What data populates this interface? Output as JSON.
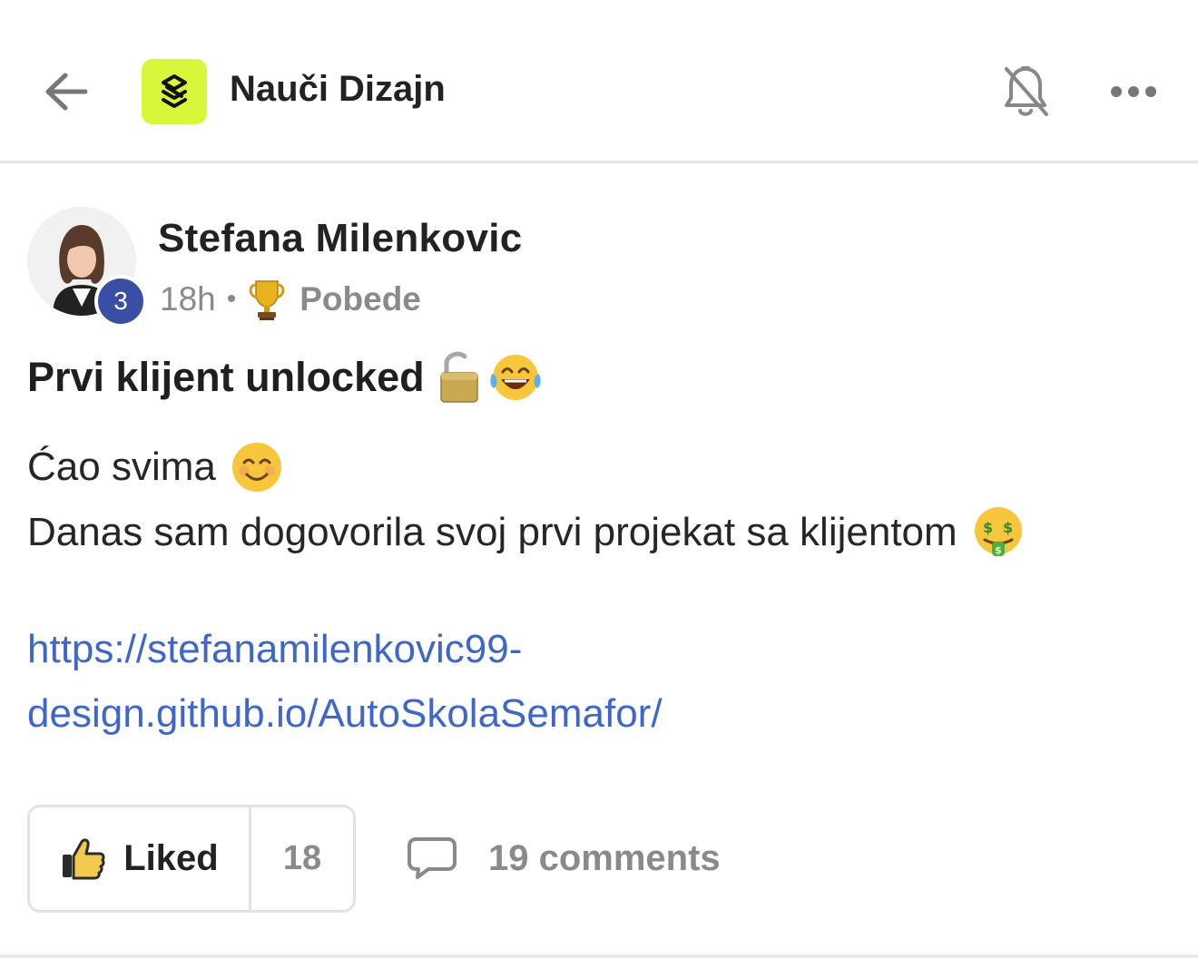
{
  "header": {
    "group_name": "Nauči Dizajn",
    "back_icon": "arrow-left-icon",
    "logo_icon": "stacked-chevrons-logo",
    "logo_color": "#d9f73a",
    "mute_icon": "bell-muted-icon",
    "more_icon": "more-dots-icon"
  },
  "post": {
    "author": "Stefana Milenkovic",
    "level": "3",
    "time": "18h",
    "separator": "•",
    "category": "Pobede",
    "category_icon": "trophy-icon",
    "title": "Prvi klijent unlocked",
    "title_emojis": [
      "unlocked-padlock-emoji",
      "tears-of-joy-emoji"
    ],
    "body": [
      {
        "text": "Ćao svima",
        "emoji": "smiling-face-emoji"
      },
      {
        "text": "Danas sam dogovorila svoj prvi projekat sa klijentom",
        "emoji": "money-mouth-face-emoji"
      }
    ],
    "link_line1": "https://stefanamilenkovic99-",
    "link_line2": "design.github.io/AutoSkolaSemafor/"
  },
  "actions": {
    "like_label": "Liked",
    "like_count": "18",
    "comments_label": "19 comments",
    "link_color": "#3e67c9",
    "level_badge_color": "#3b4ea6"
  }
}
